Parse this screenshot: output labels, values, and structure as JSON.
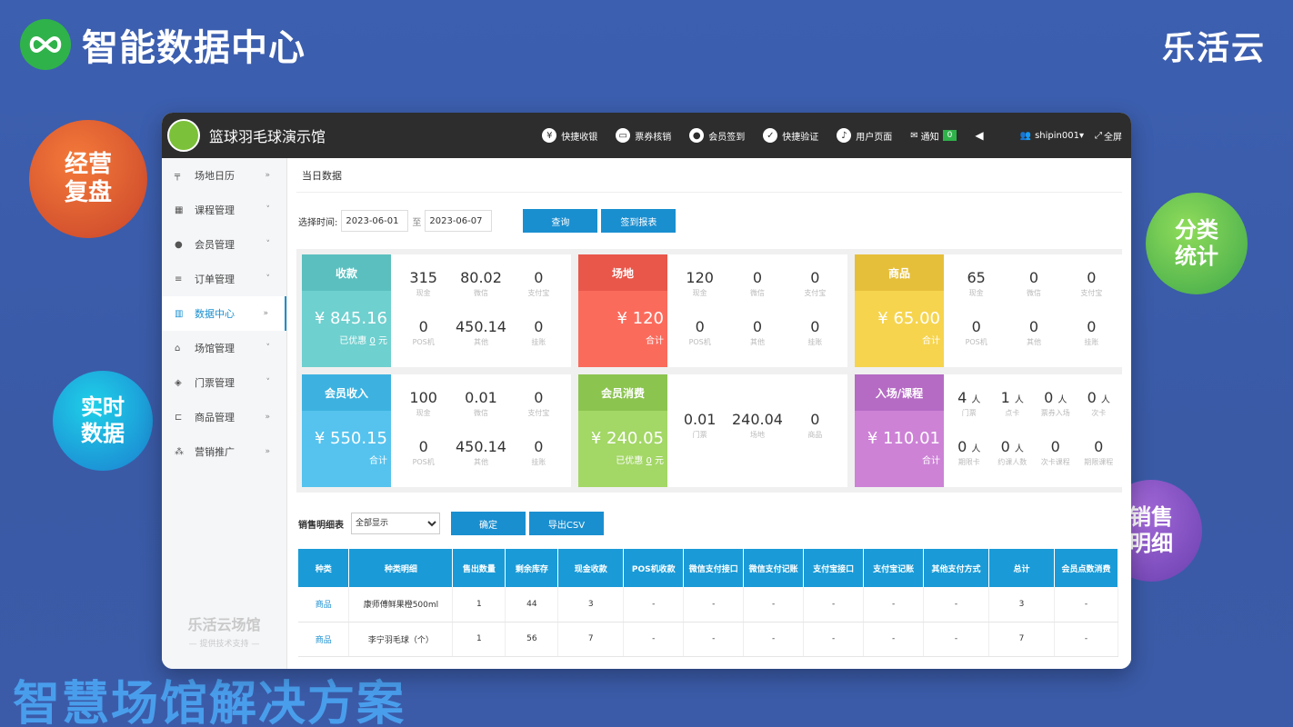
{
  "header": {
    "title": "智能数据中心",
    "brand": "乐活云"
  },
  "bubbles": {
    "b1": [
      "经营",
      "复盘"
    ],
    "b2": [
      "分类",
      "统计"
    ],
    "b3": [
      "实时",
      "数据"
    ],
    "b4": [
      "销售",
      "明细"
    ]
  },
  "slogan": "智慧场馆解决方案",
  "app": {
    "title": "篮球羽毛球演示馆",
    "toolbar": [
      {
        "label": "快捷收银",
        "icon": "yen-icon"
      },
      {
        "label": "票券核销",
        "icon": "ticket-icon"
      },
      {
        "label": "会员签到",
        "icon": "user-icon"
      },
      {
        "label": "快捷验证",
        "icon": "verify-icon"
      },
      {
        "label": "用户页面",
        "icon": "tiktok-icon"
      }
    ],
    "notify": {
      "label": "通知",
      "count": "0"
    },
    "user": "shipin001",
    "fullscreen": "全屏"
  },
  "sidebar": {
    "items": [
      {
        "label": "场地日历",
        "arrow": "»"
      },
      {
        "label": "课程管理",
        "arrow": "˅"
      },
      {
        "label": "会员管理",
        "arrow": "˅"
      },
      {
        "label": "订单管理",
        "arrow": "˅"
      },
      {
        "label": "数据中心",
        "arrow": "»"
      },
      {
        "label": "场馆管理",
        "arrow": "˅"
      },
      {
        "label": "门票管理",
        "arrow": "˅"
      },
      {
        "label": "商品管理",
        "arrow": "»"
      },
      {
        "label": "营销推广",
        "arrow": "»"
      }
    ],
    "footer": {
      "line1": "乐活云场馆",
      "line2": "— 提供技术支持 —"
    }
  },
  "main": {
    "section_title": "当日数据",
    "filter": {
      "label": "选择时间:",
      "start": "2023-06-01",
      "to": "至",
      "end": "2023-06-07",
      "query": "查询",
      "report": "签到报表"
    },
    "cards": [
      {
        "title": "收款",
        "amount": "¥ 845.16",
        "sub_prefix": "已优惠",
        "sub_value": "0",
        "sub_suffix": "元",
        "head_color": "#5bbfbf",
        "body_color": "#6ed0cf",
        "cells": [
          {
            "v": "315",
            "l": "现金"
          },
          {
            "v": "80.02",
            "l": "微信"
          },
          {
            "v": "0",
            "l": "支付宝"
          },
          {
            "v": "0",
            "l": "POS机"
          },
          {
            "v": "450.14",
            "l": "其他"
          },
          {
            "v": "0",
            "l": "挂账"
          }
        ]
      },
      {
        "title": "场地",
        "amount": "¥ 120",
        "sub_prefix": "合计",
        "sub_value": "",
        "sub_suffix": "",
        "head_color": "#e8574a",
        "body_color": "#fb6b5c",
        "cells": [
          {
            "v": "120",
            "l": "现金"
          },
          {
            "v": "0",
            "l": "微信"
          },
          {
            "v": "0",
            "l": "支付宝"
          },
          {
            "v": "0",
            "l": "POS机"
          },
          {
            "v": "0",
            "l": "其他"
          },
          {
            "v": "0",
            "l": "挂账"
          }
        ]
      },
      {
        "title": "商品",
        "amount": "¥ 65.00",
        "sub_prefix": "合计",
        "sub_value": "",
        "sub_suffix": "",
        "head_color": "#e6bf3a",
        "body_color": "#f6d44e",
        "cells": [
          {
            "v": "65",
            "l": "现金"
          },
          {
            "v": "0",
            "l": "微信"
          },
          {
            "v": "0",
            "l": "支付宝"
          },
          {
            "v": "0",
            "l": "POS机"
          },
          {
            "v": "0",
            "l": "其他"
          },
          {
            "v": "0",
            "l": "挂账"
          }
        ]
      },
      {
        "title": "会员收入",
        "amount": "¥ 550.15",
        "sub_prefix": "合计",
        "sub_value": "",
        "sub_suffix": "",
        "head_color": "#3db2e0",
        "body_color": "#55c3ee",
        "cells": [
          {
            "v": "100",
            "l": "现金"
          },
          {
            "v": "0.01",
            "l": "微信"
          },
          {
            "v": "0",
            "l": "支付宝"
          },
          {
            "v": "0",
            "l": "POS机"
          },
          {
            "v": "450.14",
            "l": "其他"
          },
          {
            "v": "0",
            "l": "挂账"
          }
        ]
      },
      {
        "title": "会员消费",
        "amount": "¥ 240.05",
        "sub_prefix": "已优惠",
        "sub_value": "0",
        "sub_suffix": "元",
        "head_color": "#8cc450",
        "body_color": "#a3d766",
        "cells": [
          {
            "v": "0.01",
            "l": "门票"
          },
          {
            "v": "240.04",
            "l": "场地"
          },
          {
            "v": "0",
            "l": "商品"
          }
        ]
      },
      {
        "title": "入场/课程",
        "amount": "¥ 110.01",
        "sub_prefix": "合计",
        "sub_value": "",
        "sub_suffix": "",
        "head_color": "#b56bc4",
        "body_color": "#cd82d6",
        "cells": [
          {
            "v": "4",
            "u": "人",
            "l": "门票"
          },
          {
            "v": "1",
            "u": "人",
            "l": "点卡"
          },
          {
            "v": "0",
            "u": "人",
            "l": "票券入场"
          },
          {
            "v": "0",
            "u": "人",
            "l": "次卡"
          },
          {
            "v": "0",
            "u": "人",
            "l": "期限卡"
          },
          {
            "v": "0",
            "u": "人",
            "l": "约课人数"
          },
          {
            "v": "0",
            "u": "",
            "l": "次卡课程"
          },
          {
            "v": "0",
            "u": "",
            "l": "期限课程"
          }
        ]
      }
    ],
    "sales": {
      "label": "销售明细表",
      "select": "全部显示",
      "ok": "确定",
      "csv": "导出CSV",
      "columns": [
        "种类",
        "种类明细",
        "售出数量",
        "剩余库存",
        "现金收款",
        "POS机收款",
        "微信支付接口",
        "微信支付记账",
        "支付宝接口",
        "支付宝记账",
        "其他支付方式",
        "总计",
        "会员点数消费"
      ],
      "rows": [
        [
          "商品",
          "康师傅鲜果橙500ml",
          "1",
          "44",
          "3",
          "-",
          "-",
          "-",
          "-",
          "-",
          "-",
          "3",
          "-"
        ],
        [
          "商品",
          "李宁羽毛球（个）",
          "1",
          "56",
          "7",
          "-",
          "-",
          "-",
          "-",
          "-",
          "-",
          "7",
          "-"
        ]
      ]
    }
  }
}
